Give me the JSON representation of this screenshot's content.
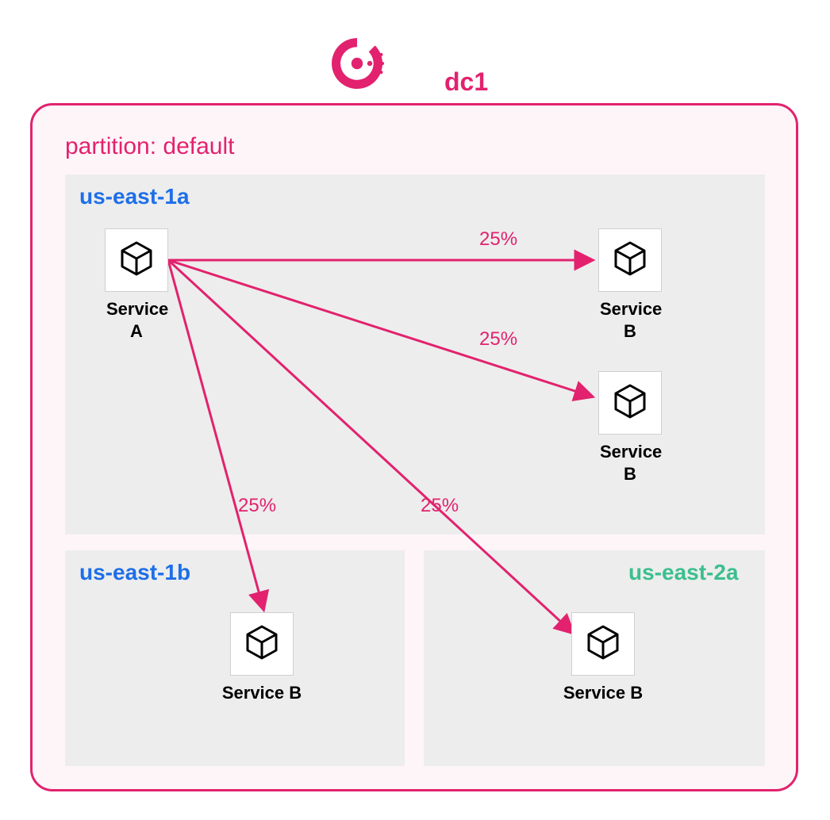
{
  "datacenter": {
    "name": "dc1"
  },
  "partition": {
    "label": "partition: default"
  },
  "zones": {
    "z1a": {
      "name": "us-east-1a"
    },
    "z1b": {
      "name": "us-east-1b"
    },
    "z2a": {
      "name": "us-east-2a"
    }
  },
  "services": {
    "a": {
      "label": "Service\nA"
    },
    "b1": {
      "label": "Service\nB"
    },
    "b2": {
      "label": "Service\nB"
    },
    "b3": {
      "label": "Service B"
    },
    "b4": {
      "label": "Service B"
    }
  },
  "edges": {
    "a_b1": {
      "pct": "25%"
    },
    "a_b2": {
      "pct": "25%"
    },
    "a_b3": {
      "pct": "25%"
    },
    "a_b4": {
      "pct": "25%"
    }
  },
  "colors": {
    "brand": "#e2226e",
    "zone_blue": "#1d6fe8",
    "zone_green": "#3bbf8f",
    "zone_bg": "#ededed",
    "frame_bg": "#fef5f9"
  }
}
